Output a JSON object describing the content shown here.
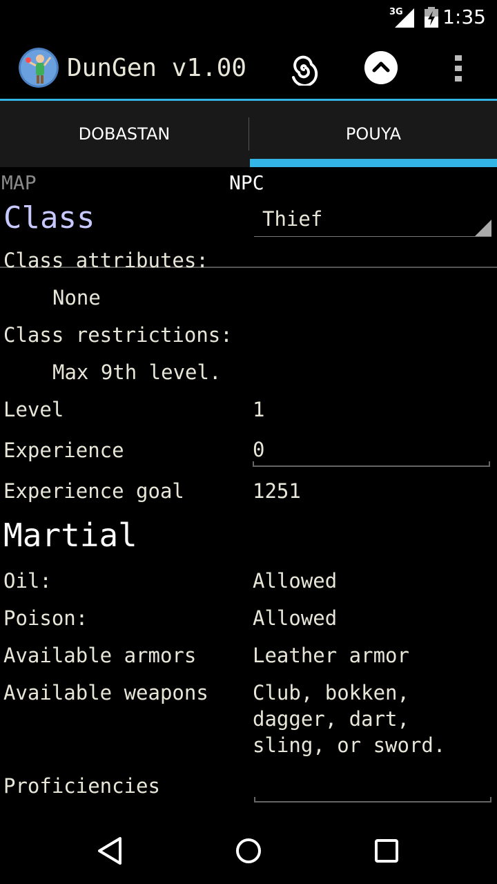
{
  "status_bar": {
    "network_label": "3G",
    "time": "1:35",
    "icons": [
      "signal-icon",
      "battery-charging-icon"
    ]
  },
  "action_bar": {
    "title": "DunGen v1.00",
    "icons": [
      "app-logo-icon",
      "swirl-icon",
      "chevron-up-icon",
      "overflow-menu-icon"
    ]
  },
  "tabs": [
    {
      "label": "DOBASTAN",
      "selected": false
    },
    {
      "label": "POUYA",
      "selected": true
    }
  ],
  "subtabs": {
    "map": "MAP",
    "npc": "NPC"
  },
  "class_section": {
    "heading": "Class",
    "selected_class": "Thief",
    "attributes_label": "Class attributes:",
    "attributes_value": "None",
    "restrictions_label": "Class restrictions:",
    "restrictions_value": "Max 9th level.",
    "level_label": "Level",
    "level_value": "1",
    "experience_label": "Experience",
    "experience_value": "0",
    "experience_goal_label": "Experience goal",
    "experience_goal_value": "1251"
  },
  "martial_section": {
    "heading": "Martial",
    "oil_label": "Oil:",
    "oil_value": "Allowed",
    "poison_label": "Poison:",
    "poison_value": "Allowed",
    "armors_label": "Available armors",
    "armors_value": "Leather armor",
    "weapons_label": "Available weapons",
    "weapons_line1": "Club, bokken,",
    "weapons_line2": "dagger, dart,",
    "weapons_line3": "sling, or sword.",
    "proficiencies_label": "Proficiencies",
    "proficiencies_value": ""
  },
  "colors": {
    "accent": "#33b5e5",
    "class_heading": "#c6c8ff",
    "text": "#e8e6d8",
    "tab_bar_bg": "#191919"
  },
  "nav_bar": {
    "icons": [
      "back-icon",
      "home-icon",
      "recents-icon"
    ]
  }
}
